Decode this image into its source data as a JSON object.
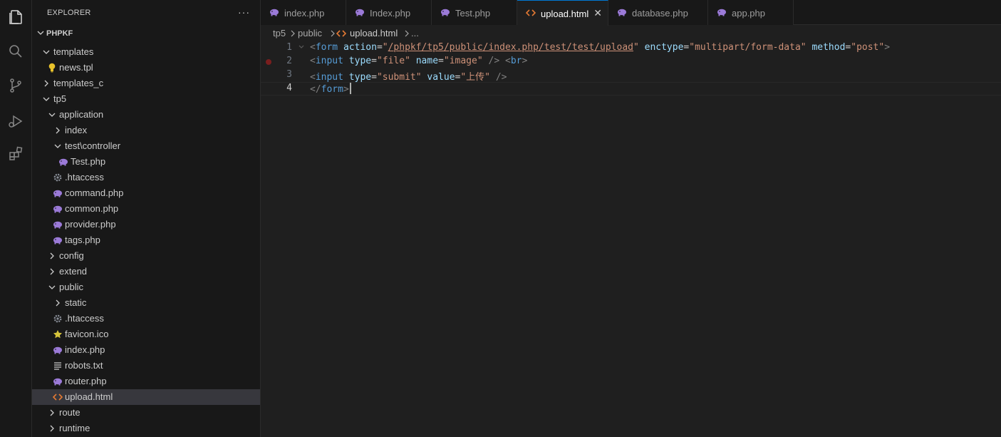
{
  "explorer": {
    "title": "EXPLORER",
    "more": "···",
    "root": "PHPKF"
  },
  "tree": [
    {
      "label": "templates",
      "depth": 0,
      "type": "folder-open"
    },
    {
      "label": "news.tpl",
      "depth": 1,
      "type": "file",
      "icon": "lightbulb-icon",
      "color": "#e8c22b"
    },
    {
      "label": "templates_c",
      "depth": 0,
      "type": "folder-closed"
    },
    {
      "label": "tp5",
      "depth": 0,
      "type": "folder-open"
    },
    {
      "label": "application",
      "depth": 1,
      "type": "folder-open"
    },
    {
      "label": "index",
      "depth": 2,
      "type": "folder-closed"
    },
    {
      "label": "test\\controller",
      "depth": 2,
      "type": "folder-open"
    },
    {
      "label": "Test.php",
      "depth": 3,
      "type": "file",
      "icon": "php-elephant-icon",
      "color": "#9b7ad8"
    },
    {
      "label": ".htaccess",
      "depth": 2,
      "type": "file",
      "icon": "gear-icon",
      "color": "#8a8f99"
    },
    {
      "label": "command.php",
      "depth": 2,
      "type": "file",
      "icon": "php-elephant-icon",
      "color": "#9b7ad8"
    },
    {
      "label": "common.php",
      "depth": 2,
      "type": "file",
      "icon": "php-elephant-icon",
      "color": "#9b7ad8"
    },
    {
      "label": "provider.php",
      "depth": 2,
      "type": "file",
      "icon": "php-elephant-icon",
      "color": "#9b7ad8"
    },
    {
      "label": "tags.php",
      "depth": 2,
      "type": "file",
      "icon": "php-elephant-icon",
      "color": "#9b7ad8"
    },
    {
      "label": "config",
      "depth": 1,
      "type": "folder-closed"
    },
    {
      "label": "extend",
      "depth": 1,
      "type": "folder-closed"
    },
    {
      "label": "public",
      "depth": 1,
      "type": "folder-open"
    },
    {
      "label": "static",
      "depth": 2,
      "type": "folder-closed"
    },
    {
      "label": ".htaccess",
      "depth": 2,
      "type": "file",
      "icon": "gear-icon",
      "color": "#8a8f99"
    },
    {
      "label": "favicon.ico",
      "depth": 2,
      "type": "file",
      "icon": "star-icon",
      "color": "#d6c43a"
    },
    {
      "label": "index.php",
      "depth": 2,
      "type": "file",
      "icon": "php-elephant-icon",
      "color": "#9b7ad8"
    },
    {
      "label": "robots.txt",
      "depth": 2,
      "type": "file",
      "icon": "text-lines-icon",
      "color": "#cccccc"
    },
    {
      "label": "router.php",
      "depth": 2,
      "type": "file",
      "icon": "php-elephant-icon",
      "color": "#9b7ad8"
    },
    {
      "label": "upload.html",
      "depth": 2,
      "type": "file",
      "icon": "html-brackets-icon",
      "color": "#e37933",
      "selected": true
    },
    {
      "label": "route",
      "depth": 1,
      "type": "folder-closed"
    },
    {
      "label": "runtime",
      "depth": 1,
      "type": "folder-closed"
    }
  ],
  "tabs": [
    {
      "label": "index.php",
      "icon": "php-elephant-icon",
      "active": false
    },
    {
      "label": "Index.php",
      "icon": "php-elephant-icon",
      "active": false
    },
    {
      "label": "Test.php",
      "icon": "php-elephant-icon",
      "active": false
    },
    {
      "label": "upload.html",
      "icon": "html-brackets-icon",
      "active": true,
      "close": "✕"
    },
    {
      "label": "database.php",
      "icon": "php-elephant-icon",
      "active": false
    },
    {
      "label": "app.php",
      "icon": "php-elephant-icon",
      "active": false
    }
  ],
  "breadcrumb": {
    "parts": [
      "tp5",
      "public",
      "upload.html",
      "..."
    ]
  },
  "editor": {
    "lines": [
      {
        "num": "1",
        "tokens": [
          [
            "punc",
            "<"
          ],
          [
            "tag",
            "form"
          ],
          [
            "sp",
            " "
          ],
          [
            "attr",
            "action"
          ],
          [
            "eq",
            "="
          ],
          [
            "str",
            "\""
          ],
          [
            "link",
            "/phpkf/tp5/public/index.php/test/test/upload"
          ],
          [
            "str",
            "\""
          ],
          [
            "sp",
            " "
          ],
          [
            "attr",
            "enctype"
          ],
          [
            "eq",
            "="
          ],
          [
            "str",
            "\"multipart/form-data\""
          ],
          [
            "sp",
            " "
          ],
          [
            "attr",
            "method"
          ],
          [
            "eq",
            "="
          ],
          [
            "str",
            "\"post\""
          ],
          [
            "punc",
            ">"
          ]
        ]
      },
      {
        "num": "2",
        "tokens": [
          [
            "punc",
            "<"
          ],
          [
            "tag",
            "input"
          ],
          [
            "sp",
            " "
          ],
          [
            "attr",
            "type"
          ],
          [
            "eq",
            "="
          ],
          [
            "str",
            "\"file\""
          ],
          [
            "sp",
            " "
          ],
          [
            "attr",
            "name"
          ],
          [
            "eq",
            "="
          ],
          [
            "str",
            "\"image\""
          ],
          [
            "sp",
            " "
          ],
          [
            "punc",
            "/>"
          ],
          [
            "sp",
            " "
          ],
          [
            "punc",
            "<"
          ],
          [
            "tag",
            "br"
          ],
          [
            "punc",
            ">"
          ]
        ],
        "breakpoint": true
      },
      {
        "num": "3",
        "tokens": [
          [
            "punc",
            "<"
          ],
          [
            "tag",
            "input"
          ],
          [
            "sp",
            " "
          ],
          [
            "attr",
            "type"
          ],
          [
            "eq",
            "="
          ],
          [
            "str",
            "\"submit\""
          ],
          [
            "sp",
            " "
          ],
          [
            "attr",
            "value"
          ],
          [
            "eq",
            "="
          ],
          [
            "str",
            "\"上传\""
          ],
          [
            "sp",
            " "
          ],
          [
            "punc",
            "/>"
          ]
        ]
      },
      {
        "num": "4",
        "tokens": [
          [
            "punc",
            "</"
          ],
          [
            "tag",
            "form"
          ],
          [
            "punc",
            ">"
          ]
        ],
        "current": true
      }
    ]
  },
  "colors": {
    "accent": "#0078d4",
    "selection": "#37373d",
    "php": "#9b7ad8",
    "html": "#e37933"
  }
}
